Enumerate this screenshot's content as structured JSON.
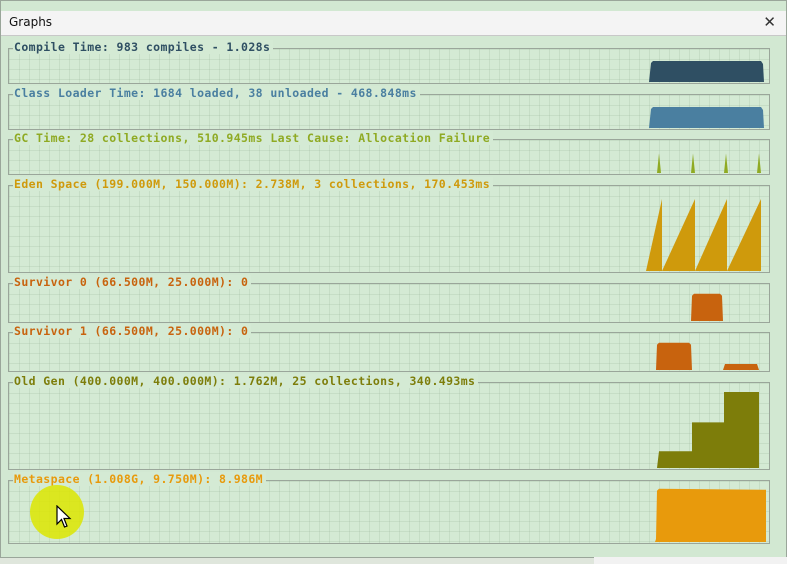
{
  "window": {
    "title": "Graphs"
  },
  "panels": [
    {
      "id": "compile",
      "label": "Compile Time: 983 compiles - 1.028s",
      "color": "#2f4f63",
      "chart": "block",
      "level": 0.75
    },
    {
      "id": "classloader",
      "label": "Class Loader Time: 1684 loaded, 38 unloaded - 468.848ms",
      "color": "#4a7fa0",
      "chart": "block",
      "level": 0.75
    },
    {
      "id": "gc",
      "label": "GC Time: 28 collections, 510.945ms Last Cause: Allocation Failure",
      "color": "#8faa23",
      "chart": "spikes",
      "level": 0.7
    },
    {
      "id": "eden",
      "label": "Eden Space (199.000M, 150.000M): 2.738M, 3 collections, 170.453ms",
      "color": "#cf9a0c",
      "chart": "sawtooth",
      "level": 0.9
    },
    {
      "id": "survivor0",
      "label": "Survivor 0 (66.500M, 25.000M): 0",
      "color": "#c8630e",
      "chart": "survivor0",
      "level": 0.85
    },
    {
      "id": "survivor1",
      "label": "Survivor 1 (66.500M, 25.000M): 0",
      "color": "#c8630e",
      "chart": "survivor1",
      "level": 0.85
    },
    {
      "id": "oldgen",
      "label": "Old Gen (400.000M, 400.000M): 1.762M, 25 collections, 340.493ms",
      "color": "#7d7d0a",
      "chart": "steps",
      "level": 0.95
    },
    {
      "id": "metaspace",
      "label": "Metaspace (1.008G, 9.750M): 8.986M",
      "color": "#e89a0c",
      "chart": "meta",
      "level": 0.95
    }
  ]
}
